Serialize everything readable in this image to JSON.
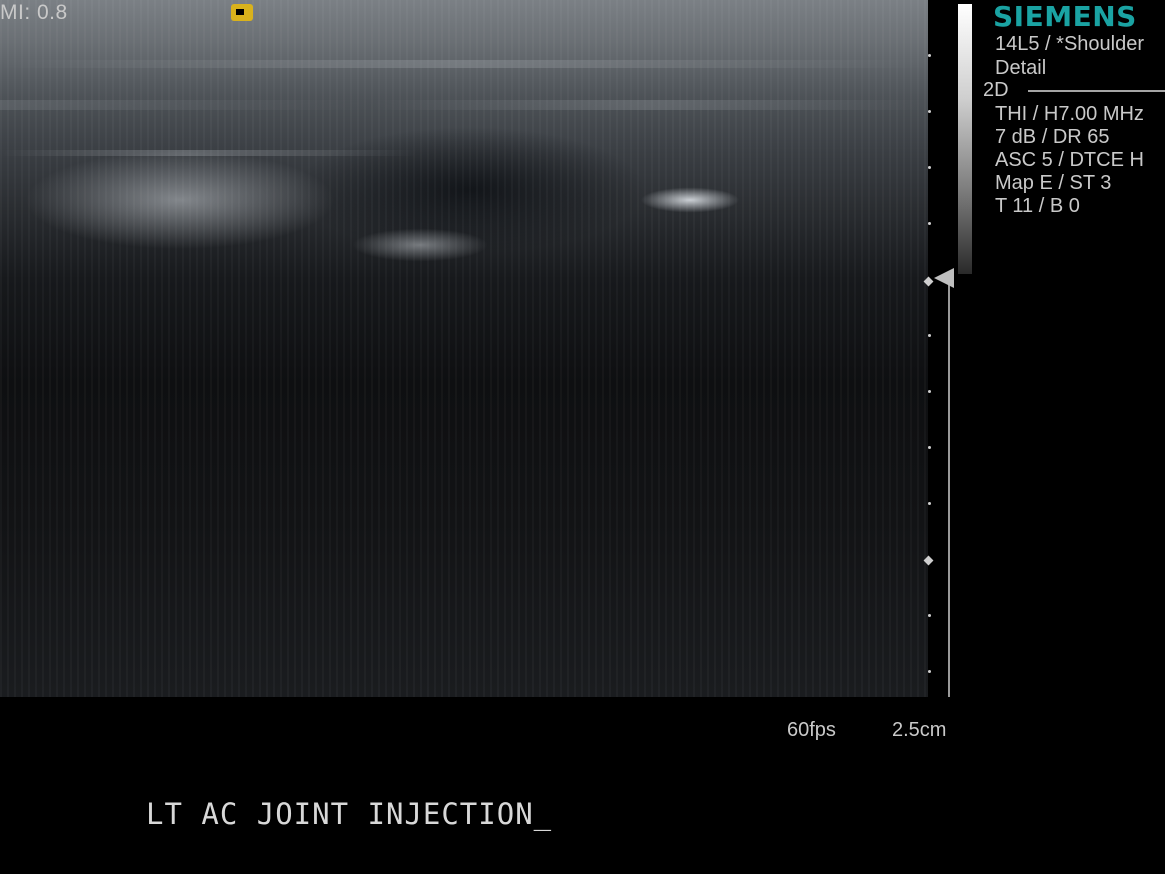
{
  "overlay": {
    "mi": "MI:  0.8",
    "brand": "SIEMENS",
    "probe_preset": "14L5 / *Shoulder",
    "detail": "Detail",
    "mode": "2D",
    "params": [
      "THI / H7.00 MHz",
      "7 dB / DR 65",
      "ASC 5 / DTCE H",
      "Map E / ST 3",
      "T 11 / B 0"
    ],
    "fps": "60fps",
    "depth": "2.5cm",
    "annotation": "LT AC JOINT INJECTION_"
  },
  "colors": {
    "brand": "#1aa3a3",
    "orientation_marker": "#d9b21c",
    "text": "#c9c9c9"
  },
  "icons": {
    "orientation_marker": "transducer-orientation-icon",
    "focus_marker": "focus-arrow-icon"
  }
}
